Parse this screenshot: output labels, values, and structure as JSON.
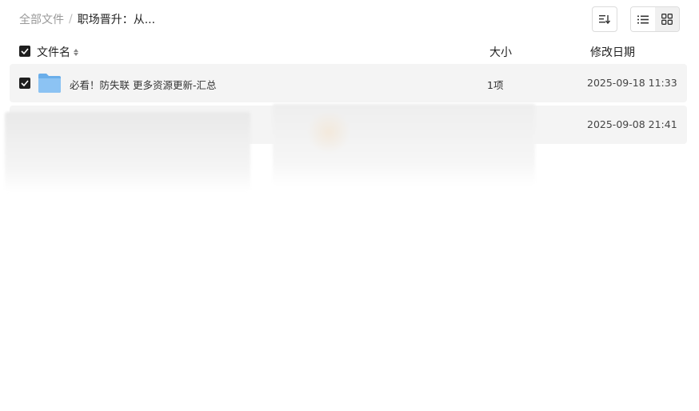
{
  "breadcrumb": {
    "root": "全部文件",
    "separator": "/",
    "current": "职场晋升：从..."
  },
  "table": {
    "headers": {
      "name": "文件名",
      "size": "大小",
      "date": "修改日期"
    },
    "rows": [
      {
        "name": "必看！防失联 更多资源更新-汇总",
        "size": "1项",
        "date": "2025-09-18 11:33",
        "checked": true,
        "icon": "folder-icon"
      },
      {
        "name": "",
        "size": "",
        "date": "2025-09-08 21:41",
        "checked": false,
        "icon": ""
      }
    ]
  },
  "toolbar": {
    "sort_icon": "sort-icon",
    "list_view_icon": "list-view-icon",
    "grid_view_icon": "grid-view-icon"
  },
  "colors": {
    "row_bg": "#f4f4f4",
    "checkbox": "#1f1f1f",
    "folder": "#7fb6ec"
  }
}
